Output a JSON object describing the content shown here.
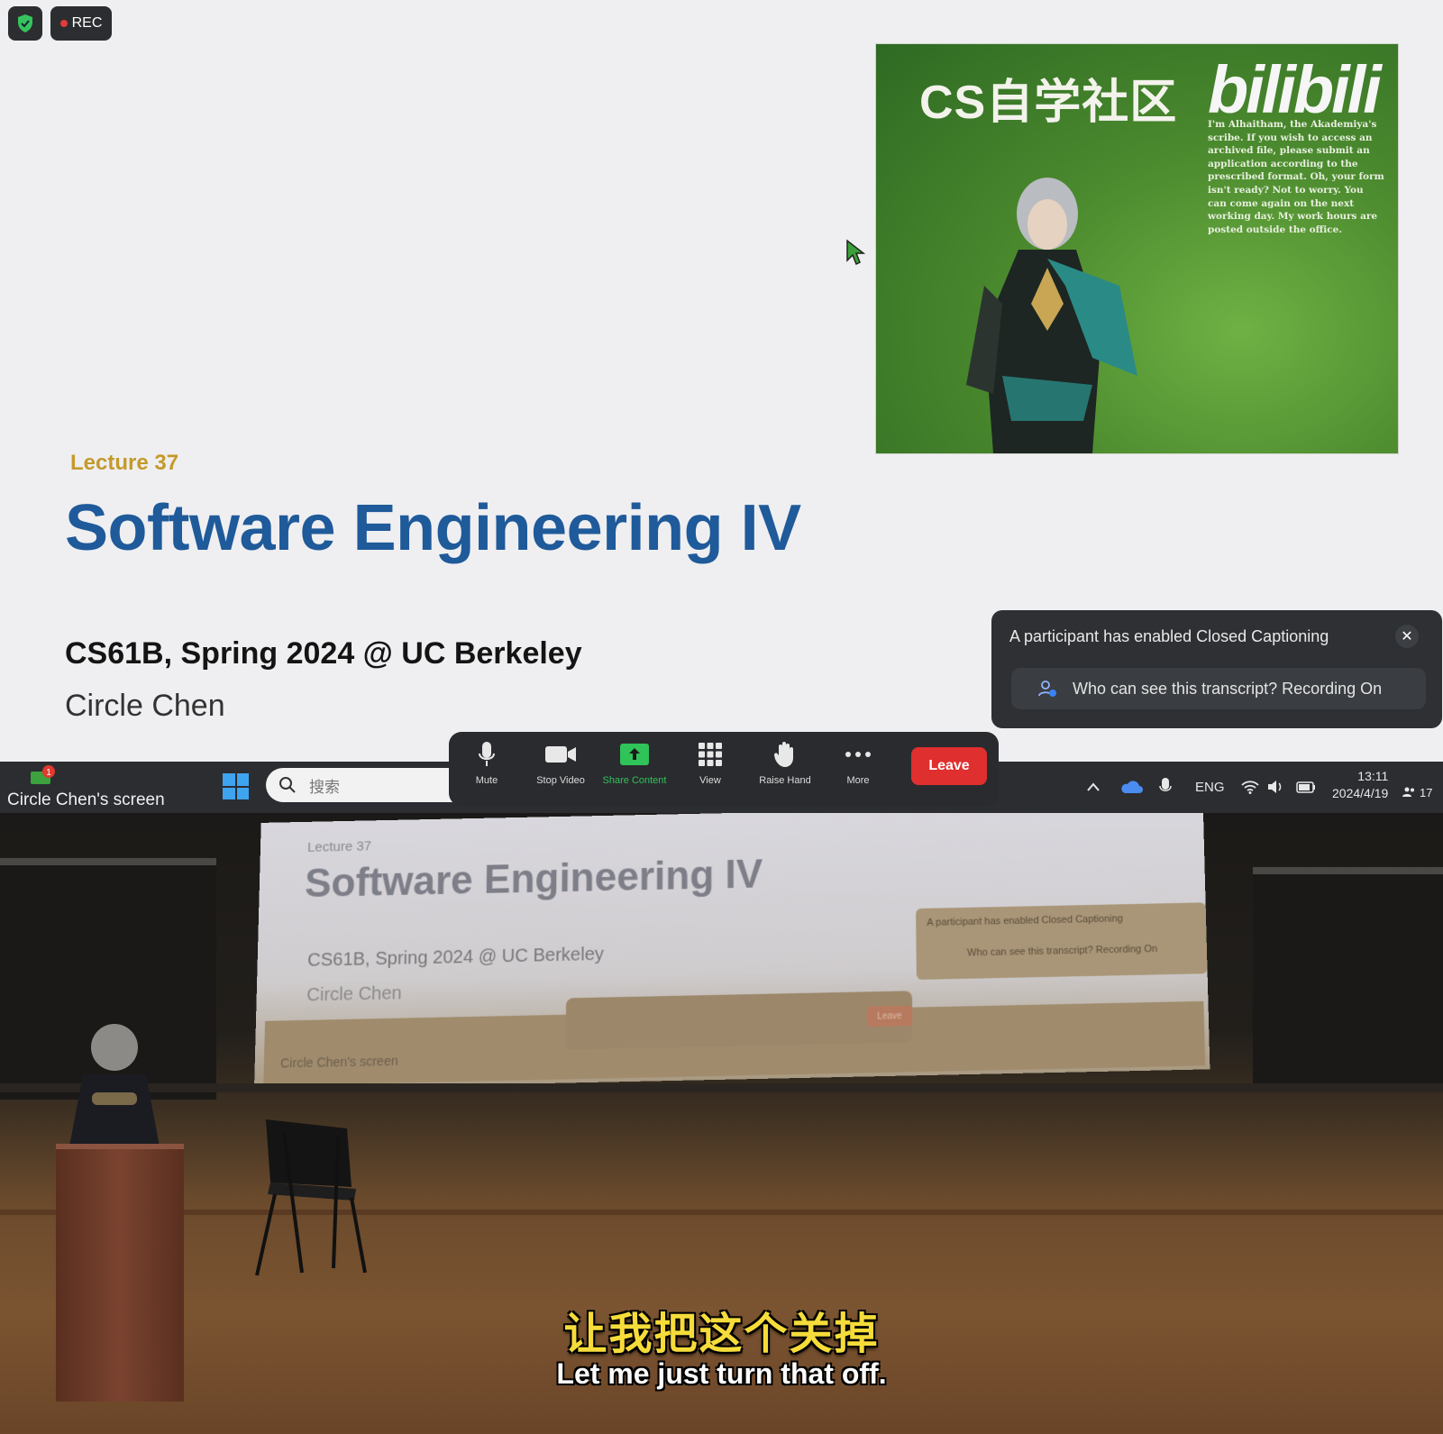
{
  "recording": {
    "rec_label": "REC"
  },
  "slide": {
    "lecture_label": "Lecture 37",
    "title": "Software Engineering IV",
    "course": "CS61B, Spring 2024 @ UC Berkeley",
    "author": "Circle Chen"
  },
  "illustration": {
    "title": "CS自学社区",
    "logo": "bilibili",
    "note": "I'm Alhaitham, the Akademiya's scribe. If you wish to access an archived file, please submit an application according to the prescribed format. Oh, your form isn't ready? Not to worry. You can come again on the next working day. My work hours are posted outside the office."
  },
  "cc_notification": {
    "title": "A participant has enabled Closed Captioning",
    "close_symbol": "✕",
    "info": "Who can see this transcript? Recording On"
  },
  "share_indicator": {
    "label": "Circle Chen's screen",
    "badge": "1"
  },
  "taskbar": {
    "search_placeholder": "搜索",
    "tray_lang": "ENG",
    "clock_time": "13:11",
    "clock_date": "2024/4/19",
    "participants": "17"
  },
  "zoom_toolbar": {
    "mute": "Mute",
    "stop_video": "Stop Video",
    "share_content": "Share Content",
    "view": "View",
    "raise_hand": "Raise Hand",
    "more": "More",
    "leave": "Leave",
    "share_color": "#2fc35a",
    "leave_color": "#e02f2f"
  },
  "projected": {
    "lecture_label": "Lecture 37",
    "title": "Software Engineering IV",
    "course": "CS61B, Spring 2024 @ UC Berkeley",
    "author": "Circle Chen",
    "popup_title": "A participant has enabled Closed Captioning",
    "popup_info": "Who can see this transcript? Recording On",
    "screen_label": "Circle Chen's screen",
    "leave": "Leave"
  },
  "subtitles": {
    "chinese": "让我把这个关掉",
    "english": "Let me just turn that off."
  },
  "colors": {
    "title_blue": "#1f5a9a",
    "lecture_gold": "#c49a2c",
    "subtitle_yellow": "#f6dc3a"
  }
}
